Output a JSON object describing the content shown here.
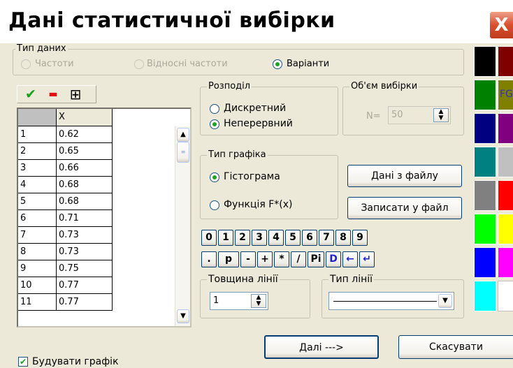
{
  "window": {
    "title": "Дані статистичної вибірки",
    "close_glyph": "X"
  },
  "data_type": {
    "legend": "Тип даних",
    "options": [
      "Частоти",
      "Відносні частоти",
      "Варіанти"
    ],
    "selected": "Варіанти"
  },
  "toolbar": {
    "check_glyph": "✔",
    "minus_glyph": "▬",
    "grid_glyph": "⊞"
  },
  "table": {
    "header": "X",
    "rows": [
      {
        "n": "1",
        "x": "0.62"
      },
      {
        "n": "2",
        "x": "0.65"
      },
      {
        "n": "3",
        "x": "0.66"
      },
      {
        "n": "4",
        "x": "0.68"
      },
      {
        "n": "5",
        "x": "0.68"
      },
      {
        "n": "6",
        "x": "0.71"
      },
      {
        "n": "7",
        "x": "0.73"
      },
      {
        "n": "8",
        "x": "0.73"
      },
      {
        "n": "9",
        "x": "0.75"
      },
      {
        "n": "10",
        "x": "0.77"
      },
      {
        "n": "11",
        "x": "0.77"
      }
    ]
  },
  "distribution": {
    "legend": "Розподіл",
    "options": [
      "Дискретний",
      "Неперервний"
    ],
    "selected": "Неперервний"
  },
  "sample_size": {
    "legend": "Об'єм вибірки",
    "label": "N=",
    "value": "50"
  },
  "chart_type": {
    "legend": "Тип графіка",
    "options": [
      "Гістограма",
      "Функція F*(x)"
    ],
    "selected": "Гістограма"
  },
  "buttons": {
    "load_file": "Дані з файлу",
    "save_file": "Записати у файл",
    "next": "Далі --->",
    "cancel": "Скасувати"
  },
  "keypad": {
    "row1": [
      "0",
      "1",
      "2",
      "3",
      "4",
      "5",
      "6",
      "7",
      "8",
      "9"
    ],
    "row2": [
      ".",
      "p",
      "-",
      "+",
      "*",
      "/",
      "Pi",
      "D",
      "←",
      "↵"
    ]
  },
  "line_width": {
    "legend": "Товщина лінії",
    "value": "1"
  },
  "line_type": {
    "legend": "Тип лінії"
  },
  "build_chart": {
    "label": "Будувати графік",
    "checked": true
  },
  "palette": {
    "fg_label": "FG",
    "colors": [
      "#000000",
      "#800000",
      "#008000",
      "#808000",
      "#000080",
      "#800080",
      "#008080",
      "#c0c0c0",
      "#808080",
      "#ff0000",
      "#00ff00",
      "#ffff00",
      "#0000ff",
      "#ff00ff",
      "#00ffff",
      "#ffffff"
    ]
  }
}
